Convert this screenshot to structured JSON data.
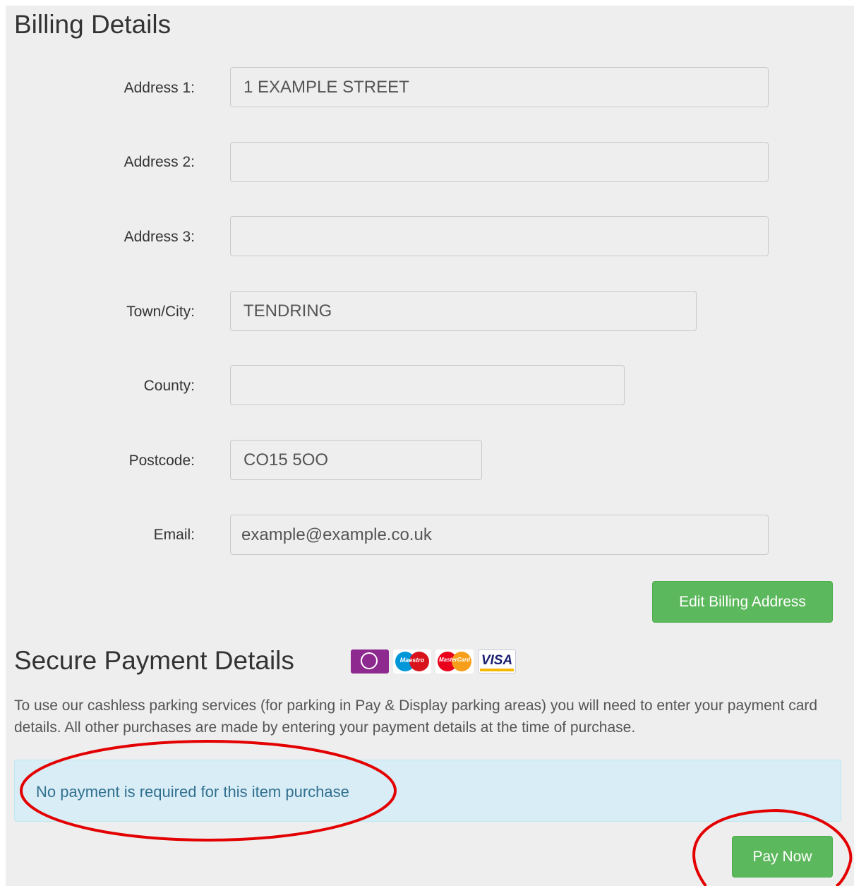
{
  "billing": {
    "title": "Billing Details",
    "fields": [
      {
        "label": "Address 1:",
        "value": "1 EXAMPLE STREET"
      },
      {
        "label": "Address 2:",
        "value": ""
      },
      {
        "label": "Address 3:",
        "value": ""
      },
      {
        "label": "Town/City:",
        "value": "TENDRING"
      },
      {
        "label": "County:",
        "value": ""
      },
      {
        "label": "Postcode:",
        "value": "CO15 5OO"
      },
      {
        "label": "Email:",
        "value": "example@example.co.uk"
      }
    ],
    "edit_button": "Edit Billing Address"
  },
  "payment": {
    "title": "Secure Payment Details",
    "card_icons": [
      "solo-card-icon",
      "maestro-card-icon",
      "mastercard-card-icon",
      "visa-card-icon"
    ],
    "card_text": {
      "maestro": "Maestro",
      "mastercard": "MasterCard",
      "visa": "VISA"
    },
    "description": "To use our cashless parking services (for parking in Pay & Display parking areas) you will need to enter your payment card details. All other purchases are made by entering your payment details at the time of purchase.",
    "notice": "No payment is required for this item purchase",
    "pay_button": "Pay Now"
  },
  "colors": {
    "button_green": "#5cb85c",
    "info_background": "#d9edf7",
    "info_text": "#31708f",
    "annotation_red": "#e30000"
  }
}
